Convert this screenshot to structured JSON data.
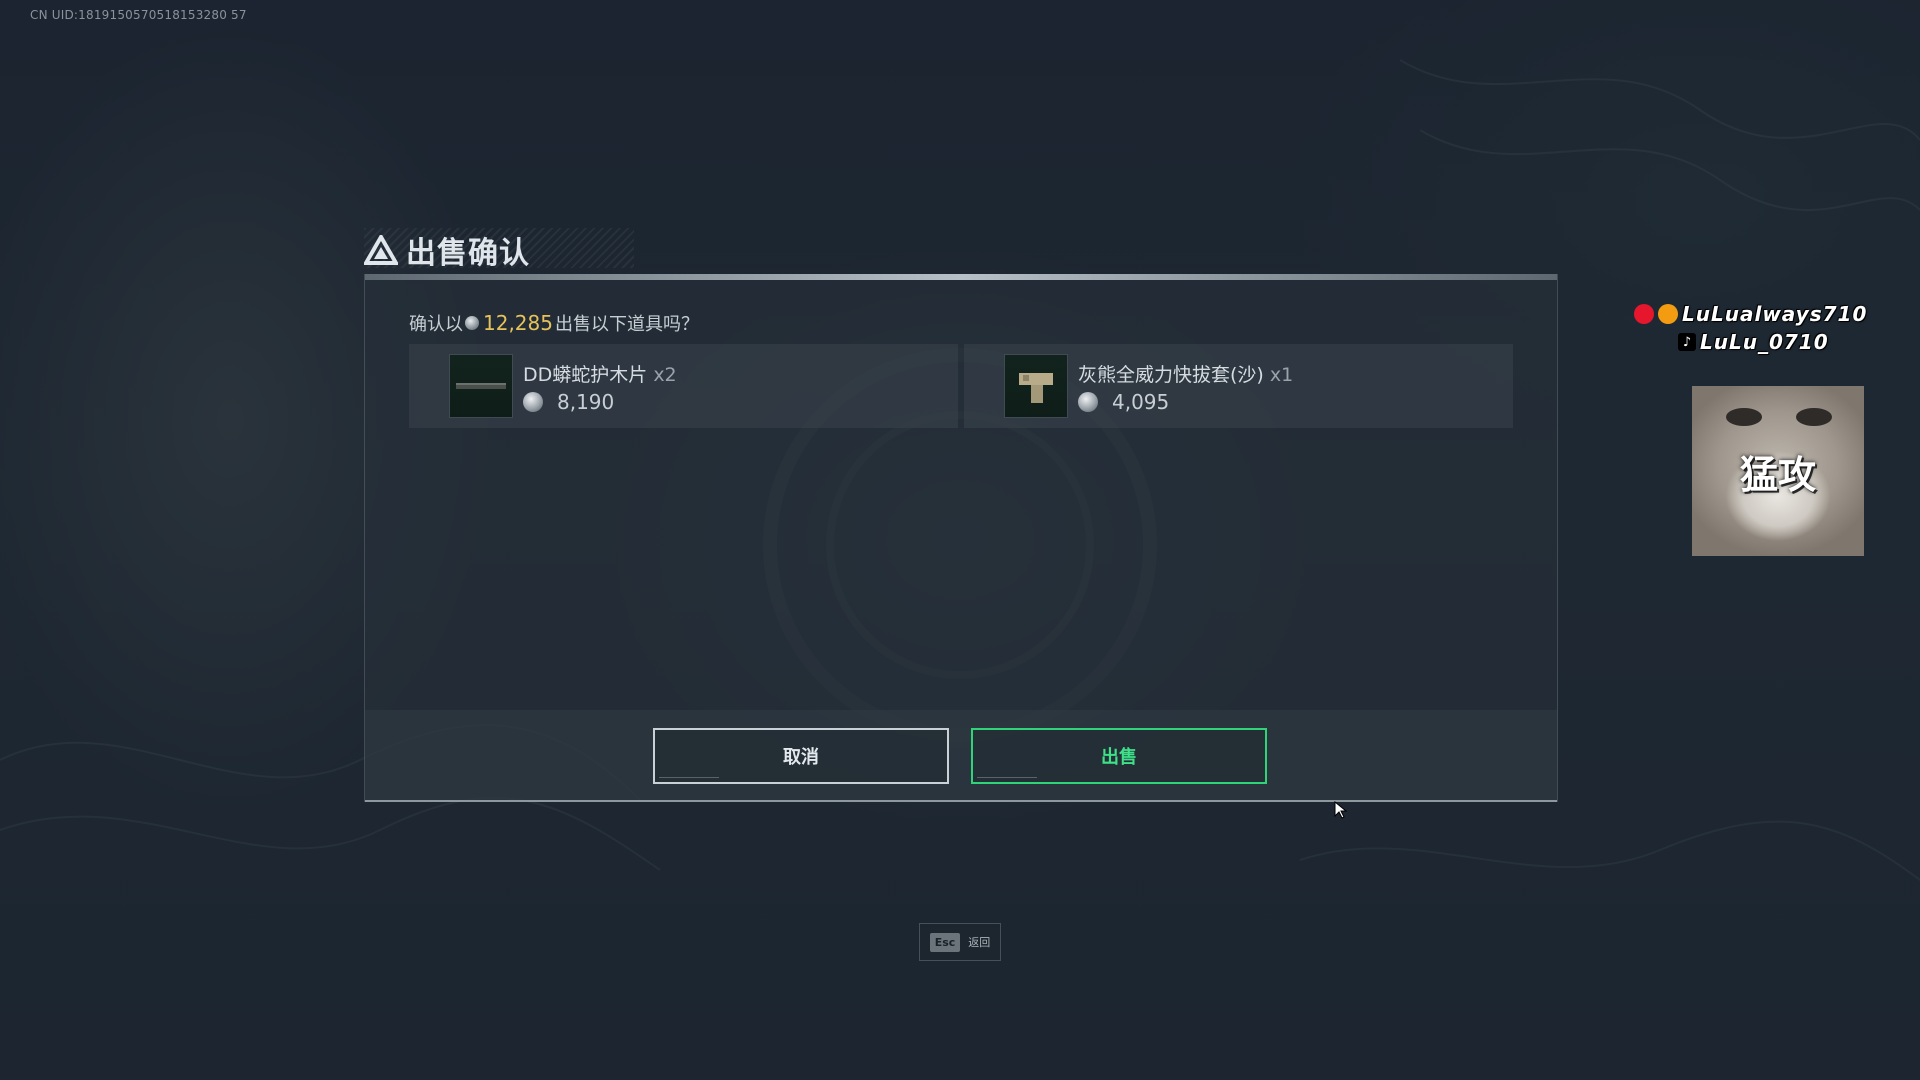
{
  "uid": "CN UID:1819150570518153280 57",
  "dialog": {
    "title": "出售确认",
    "confirm_prefix": "确认以",
    "confirm_amount": "12,285",
    "confirm_suffix": "出售以下道具吗？",
    "items": [
      {
        "name": "DD蟒蛇护木片",
        "qty": "x2",
        "price": "8,190"
      },
      {
        "name": "灰熊全威力快拔套(沙)",
        "qty": "x1",
        "price": "4,095"
      }
    ],
    "cancel_label": "取消",
    "sell_label": "出售"
  },
  "esc_hint": {
    "key": "Esc",
    "label": "返回"
  },
  "overlay": {
    "weibo_handle": "LuLualways710",
    "tiktok_handle": "LuLu_0710",
    "avatar_caption": "猛攻"
  },
  "colors": {
    "accent_sell": "#2fd479",
    "amount_gold": "#e6c25a"
  }
}
